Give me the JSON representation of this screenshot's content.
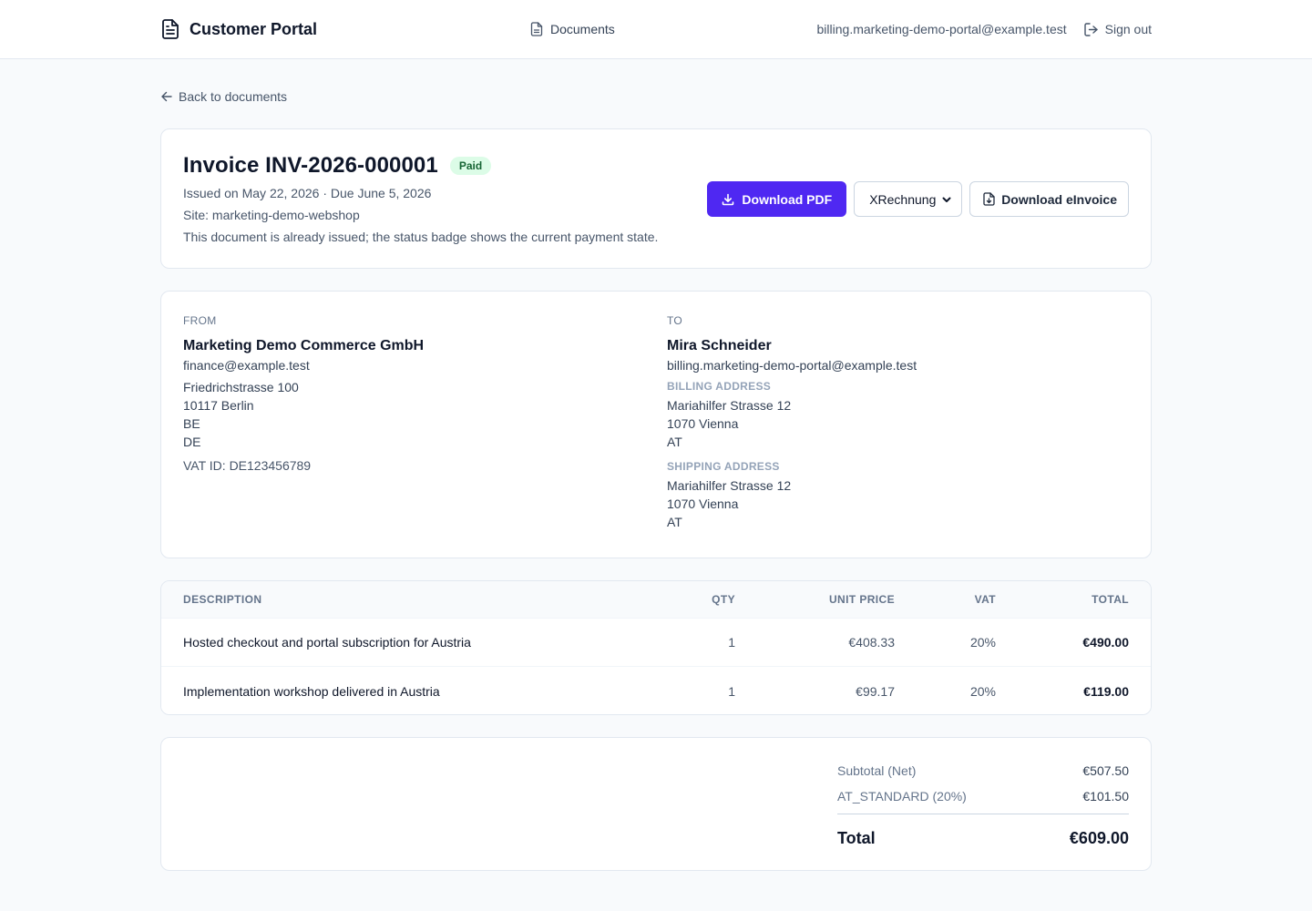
{
  "header": {
    "brand": "Customer Portal",
    "nav_documents": "Documents",
    "user_email": "billing.marketing-demo-portal@example.test",
    "sign_out": "Sign out"
  },
  "back_link": "Back to documents",
  "invoice": {
    "title": "Invoice INV-2026-000001",
    "status": "Paid",
    "status_color": "#166534",
    "status_bg": "#dcfce7",
    "issued_line": "Issued on May 22, 2026 · Due June 5, 2026",
    "site_line": "Site: marketing-demo-webshop",
    "note": "This document is already issued; the status badge shows the current payment state."
  },
  "actions": {
    "download_pdf": "Download PDF",
    "format_selected": "XRechnung",
    "download_einvoice": "Download eInvoice",
    "accent_color": "#4f28f2"
  },
  "from": {
    "label": "FROM",
    "name": "Marketing Demo Commerce GmbH",
    "email": "finance@example.test",
    "address_lines": [
      "Friedrichstrasse 100",
      "10117 Berlin",
      "BE",
      "DE"
    ],
    "vat_id": "VAT ID: DE123456789"
  },
  "to": {
    "label": "TO",
    "name": "Mira Schneider",
    "email": "billing.marketing-demo-portal@example.test",
    "billing_label": "BILLING ADDRESS",
    "billing_lines": [
      "Mariahilfer Strasse 12",
      "1070 Vienna",
      "AT"
    ],
    "shipping_label": "SHIPPING ADDRESS",
    "shipping_lines": [
      "Mariahilfer Strasse 12",
      "1070 Vienna",
      "AT"
    ]
  },
  "items": {
    "headers": [
      "DESCRIPTION",
      "QTY",
      "UNIT PRICE",
      "VAT",
      "TOTAL"
    ],
    "rows": [
      {
        "description": "Hosted checkout and portal subscription for Austria",
        "qty": "1",
        "unit_price": "€408.33",
        "vat": "20%",
        "total": "€490.00"
      },
      {
        "description": "Implementation workshop delivered in Austria",
        "qty": "1",
        "unit_price": "€99.17",
        "vat": "20%",
        "total": "€119.00"
      }
    ]
  },
  "totals": {
    "subtotal_label": "Subtotal (Net)",
    "subtotal_value": "€507.50",
    "tax_label": "AT_STANDARD (20%)",
    "tax_value": "€101.50",
    "total_label": "Total",
    "total_value": "€609.00"
  }
}
